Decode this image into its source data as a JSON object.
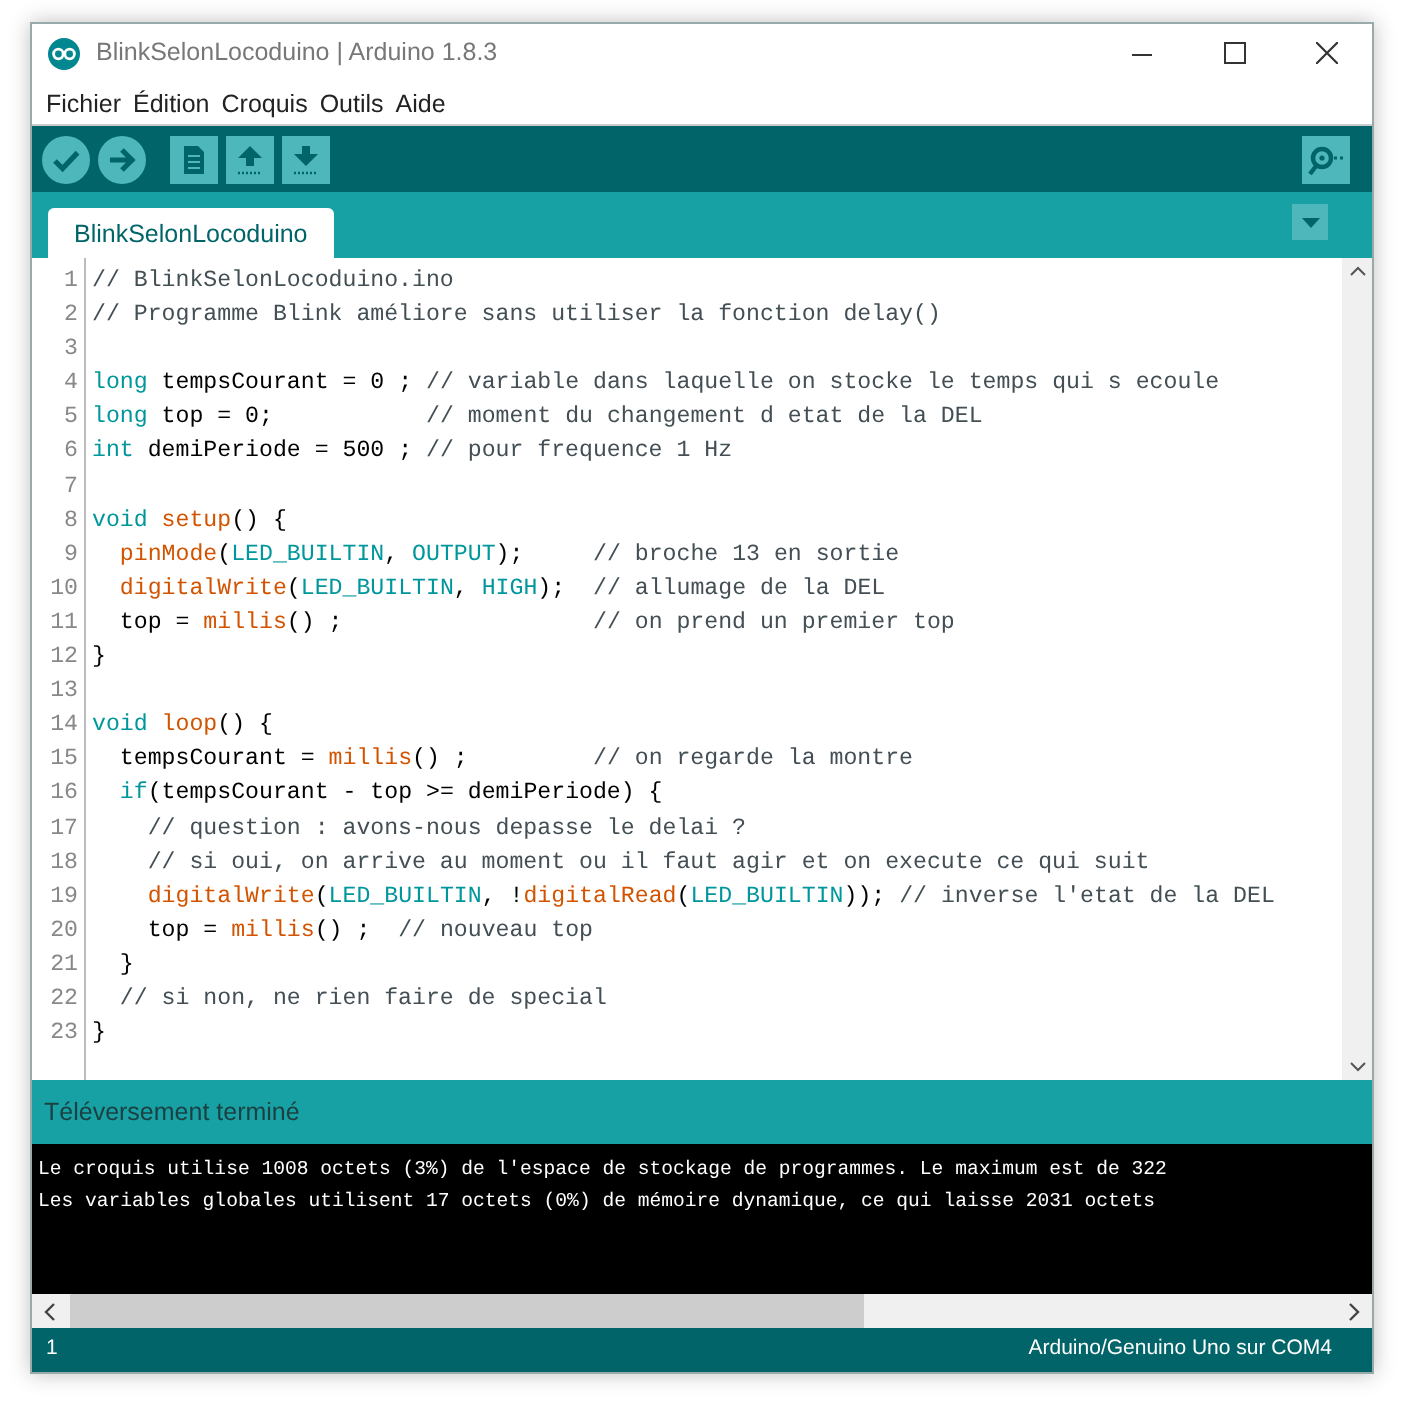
{
  "window": {
    "title": "BlinkSelonLocoduino | Arduino 1.8.3"
  },
  "menu": [
    "Fichier",
    "Édition",
    "Croquis",
    "Outils",
    "Aide"
  ],
  "tabs": [
    {
      "label": "BlinkSelonLocoduino",
      "selected": true
    }
  ],
  "editor": {
    "lines": [
      {
        "number": "1",
        "tokens": [
          {
            "kind": "comment",
            "text": "// BlinkSelonLocoduino.ino"
          }
        ]
      },
      {
        "number": "2",
        "tokens": [
          {
            "kind": "comment",
            "text": "// Programme Blink améliore sans utiliser la fonction delay()"
          }
        ]
      },
      {
        "number": "3"
      },
      {
        "number": "4",
        "tokens": [
          {
            "kind": "keyword",
            "text": "long"
          },
          {
            "kind": "plain",
            "text": " tempsCourant = 0 ; "
          },
          {
            "kind": "comment",
            "text": "// variable dans laquelle on stocke le temps qui s ecoule"
          }
        ]
      },
      {
        "number": "5",
        "tokens": [
          {
            "kind": "keyword",
            "text": "long"
          },
          {
            "kind": "plain",
            "text": " top = 0;           "
          },
          {
            "kind": "comment",
            "text": "// moment du changement d etat de la DEL"
          }
        ]
      },
      {
        "number": "6",
        "tokens": [
          {
            "kind": "keyword",
            "text": "int"
          },
          {
            "kind": "plain",
            "text": " demiPeriode = 500 ; "
          },
          {
            "kind": "comment",
            "text": "// pour frequence 1 Hz"
          }
        ]
      },
      {
        "number": "7"
      },
      {
        "number": "8",
        "tokens": [
          {
            "kind": "keyword",
            "text": "void "
          },
          {
            "kind": "function",
            "text": "setup"
          },
          {
            "kind": "plain",
            "text": "() {"
          }
        ]
      },
      {
        "number": "9",
        "tokens": [
          {
            "kind": "function",
            "text": "  pinMode"
          },
          {
            "kind": "plain",
            "text": "("
          },
          {
            "kind": "constant",
            "text": "LED_BUILTIN"
          },
          {
            "kind": "plain",
            "text": ", "
          },
          {
            "kind": "constant",
            "text": "OUTPUT"
          },
          {
            "kind": "plain",
            "text": ");     "
          },
          {
            "kind": "comment",
            "text": "// broche 13 en sortie"
          }
        ]
      },
      {
        "number": "10",
        "tokens": [
          {
            "kind": "function",
            "text": "  digitalWrite"
          },
          {
            "kind": "plain",
            "text": "("
          },
          {
            "kind": "constant",
            "text": "LED_BUILTIN"
          },
          {
            "kind": "plain",
            "text": ", "
          },
          {
            "kind": "constant",
            "text": "HIGH"
          },
          {
            "kind": "plain",
            "text": ");  "
          },
          {
            "kind": "comment",
            "text": "// allumage de la DEL"
          }
        ]
      },
      {
        "number": "11",
        "tokens": [
          {
            "kind": "plain",
            "text": "  top = "
          },
          {
            "kind": "function",
            "text": "millis"
          },
          {
            "kind": "plain",
            "text": "() ;                  "
          },
          {
            "kind": "comment",
            "text": "// on prend un premier top"
          }
        ]
      },
      {
        "number": "12",
        "tokens": [
          {
            "kind": "plain",
            "text": "}"
          }
        ]
      },
      {
        "number": "13"
      },
      {
        "number": "14",
        "tokens": [
          {
            "kind": "keyword",
            "text": "void "
          },
          {
            "kind": "function",
            "text": "loop"
          },
          {
            "kind": "plain",
            "text": "() {"
          }
        ]
      },
      {
        "number": "15",
        "tokens": [
          {
            "kind": "plain",
            "text": "  tempsCourant = "
          },
          {
            "kind": "function",
            "text": "millis"
          },
          {
            "kind": "plain",
            "text": "() ;         "
          },
          {
            "kind": "comment",
            "text": "// on regarde la montre"
          }
        ]
      },
      {
        "number": "16",
        "tokens": [
          {
            "kind": "keyword",
            "text": "  if"
          },
          {
            "kind": "plain",
            "text": "(tempsCourant - top >= demiPeriode) {"
          }
        ]
      },
      {
        "number": "17",
        "tokens": [
          {
            "kind": "comment",
            "text": "    // question : avons-nous depasse le delai ?"
          }
        ]
      },
      {
        "number": "18",
        "tokens": [
          {
            "kind": "comment",
            "text": "    // si oui, on arrive au moment ou il faut agir et on execute ce qui suit"
          }
        ]
      },
      {
        "number": "19",
        "tokens": [
          {
            "kind": "function",
            "text": "    digitalWrite"
          },
          {
            "kind": "plain",
            "text": "("
          },
          {
            "kind": "constant",
            "text": "LED_BUILTIN"
          },
          {
            "kind": "plain",
            "text": ", !"
          },
          {
            "kind": "function",
            "text": "digitalRead"
          },
          {
            "kind": "plain",
            "text": "("
          },
          {
            "kind": "constant",
            "text": "LED_BUILTIN"
          },
          {
            "kind": "plain",
            "text": ")); "
          },
          {
            "kind": "comment",
            "text": "// inverse l'etat de la DEL"
          }
        ]
      },
      {
        "number": "20",
        "tokens": [
          {
            "kind": "plain",
            "text": "    top = "
          },
          {
            "kind": "function",
            "text": "millis"
          },
          {
            "kind": "plain",
            "text": "() ;  "
          },
          {
            "kind": "comment",
            "text": "// nouveau top"
          }
        ]
      },
      {
        "number": "21",
        "tokens": [
          {
            "kind": "plain",
            "text": "  }"
          }
        ]
      },
      {
        "number": "22",
        "tokens": [
          {
            "kind": "comment",
            "text": "  // si non, ne rien faire de special"
          }
        ]
      },
      {
        "number": "23",
        "tokens": [
          {
            "kind": "plain",
            "text": "}"
          }
        ]
      }
    ]
  },
  "status_message": "Téléversement terminé",
  "console": [
    "Le croquis utilise 1008 octets (3%) de l'espace de stockage de programmes. Le maximum est de 322",
    "Les variables globales utilisent 17 octets (0%) de mémoire dynamique, ce qui laisse 2031 octets"
  ],
  "status_bar": {
    "line": "1",
    "board": "Arduino/Genuino Uno sur COM4"
  }
}
